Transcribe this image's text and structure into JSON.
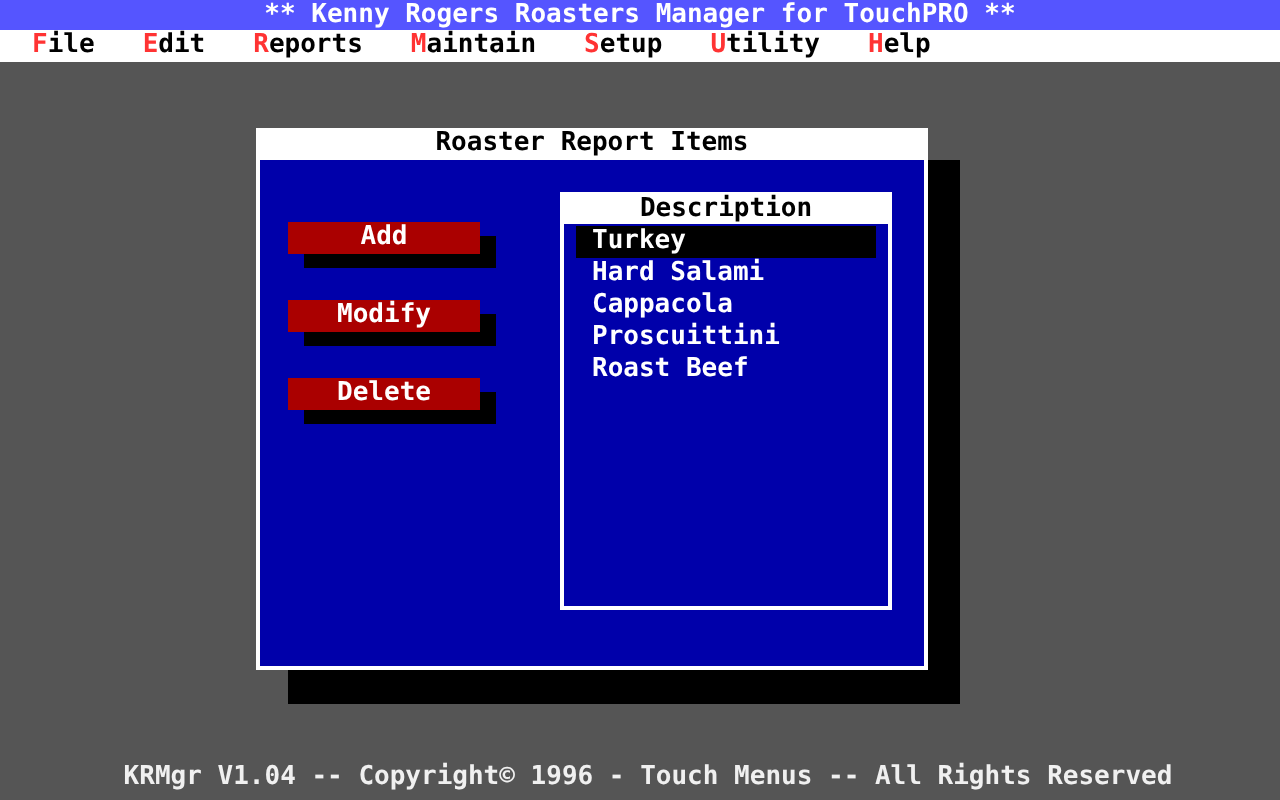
{
  "title_bar": {
    "title": "** Kenny Rogers Roasters Manager for TouchPRO **"
  },
  "menu": [
    {
      "hotkey": "F",
      "rest": "ile"
    },
    {
      "hotkey": "E",
      "rest": "dit"
    },
    {
      "hotkey": "R",
      "rest": "eports"
    },
    {
      "hotkey": "M",
      "rest": "aintain"
    },
    {
      "hotkey": "S",
      "rest": "etup"
    },
    {
      "hotkey": "U",
      "rest": "tility"
    },
    {
      "hotkey": "H",
      "rest": "elp"
    }
  ],
  "dialog": {
    "title": "Roaster Report Items",
    "buttons": [
      "Add",
      "Modify",
      "Delete"
    ],
    "list": {
      "header": "Description",
      "items": [
        {
          "label": "Turkey",
          "selected": true
        },
        {
          "label": "Hard Salami",
          "selected": false
        },
        {
          "label": "Cappacola",
          "selected": false
        },
        {
          "label": "Proscuittini",
          "selected": false
        },
        {
          "label": "Roast Beef",
          "selected": false
        }
      ]
    }
  },
  "status_bar": "KRMgr V1.04 -- Copyright© 1996 - Touch Menus -- All Rights Reserved"
}
